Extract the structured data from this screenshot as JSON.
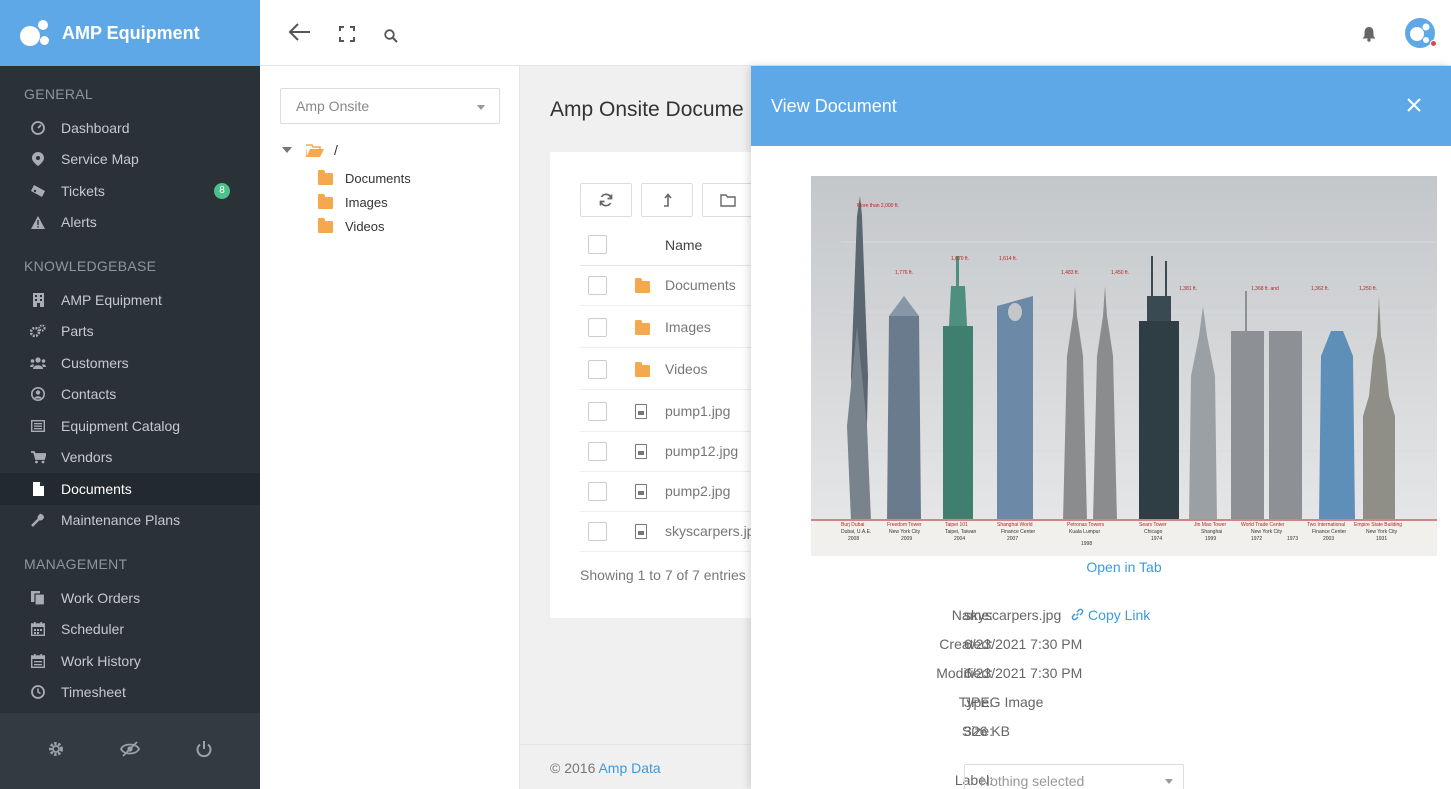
{
  "brand": {
    "title": "AMP Equipment"
  },
  "sidebar": {
    "sections": [
      {
        "heading": "GENERAL",
        "items": [
          {
            "label": "Dashboard",
            "icon": "dashboard-icon"
          },
          {
            "label": "Service Map",
            "icon": "map-pin-icon"
          },
          {
            "label": "Tickets",
            "icon": "ticket-icon",
            "badge": "8"
          },
          {
            "label": "Alerts",
            "icon": "warning-icon"
          }
        ]
      },
      {
        "heading": "KNOWLEDGEBASE",
        "items": [
          {
            "label": "AMP Equipment",
            "icon": "building-icon"
          },
          {
            "label": "Parts",
            "icon": "gears-icon"
          },
          {
            "label": "Customers",
            "icon": "users-icon"
          },
          {
            "label": "Contacts",
            "icon": "contact-icon"
          },
          {
            "label": "Equipment Catalog",
            "icon": "catalog-icon"
          },
          {
            "label": "Vendors",
            "icon": "cart-icon"
          },
          {
            "label": "Documents",
            "icon": "document-icon",
            "active": true
          },
          {
            "label": "Maintenance Plans",
            "icon": "wrench-icon"
          }
        ]
      },
      {
        "heading": "MANAGEMENT",
        "items": [
          {
            "label": "Work Orders",
            "icon": "copy-icon"
          },
          {
            "label": "Scheduler",
            "icon": "calendar-icon"
          },
          {
            "label": "Work History",
            "icon": "history-calendar-icon"
          },
          {
            "label": "Timesheet",
            "icon": "clock-icon"
          }
        ]
      }
    ]
  },
  "tree": {
    "selector": "Amp Onsite",
    "root": "/",
    "children": [
      "Documents",
      "Images",
      "Videos"
    ]
  },
  "main": {
    "title": "Amp Onsite Docume",
    "column_name": "Name",
    "rows": [
      {
        "name": "Documents",
        "type": "folder"
      },
      {
        "name": "Images",
        "type": "folder"
      },
      {
        "name": "Videos",
        "type": "folder"
      },
      {
        "name": "pump1.jpg",
        "type": "file"
      },
      {
        "name": "pump12.jpg",
        "type": "file"
      },
      {
        "name": "pump2.jpg",
        "type": "file"
      },
      {
        "name": "skyscarpers.jp",
        "type": "file"
      }
    ],
    "showing": "Showing 1 to 7 of 7 entries"
  },
  "footer": {
    "copyright": "© 2016 ",
    "link": "Amp Data"
  },
  "drawer": {
    "title": "View Document",
    "open_in_tab": "Open in Tab",
    "meta": {
      "name_label": "Name:",
      "name_value": "skyscarpers.jpg",
      "copy_link": "Copy Link",
      "created_label": "Created:",
      "created_value": "6/23/2021 7:30 PM",
      "modified_label": "Modified:",
      "modified_value": "6/23/2021 7:30 PM",
      "type_label": "Type:",
      "type_value": "JPEG Image",
      "size_label": "Size:",
      "size_value": "326 KB",
      "label_label": "Label:",
      "label_placeholder": "Nothing selected"
    }
  },
  "colors": {
    "brand": "#5ea8e8",
    "sidebar": "#2a3238",
    "link": "#3b9ae1",
    "folder": "#f5a94e",
    "badge": "#4cc08a"
  }
}
